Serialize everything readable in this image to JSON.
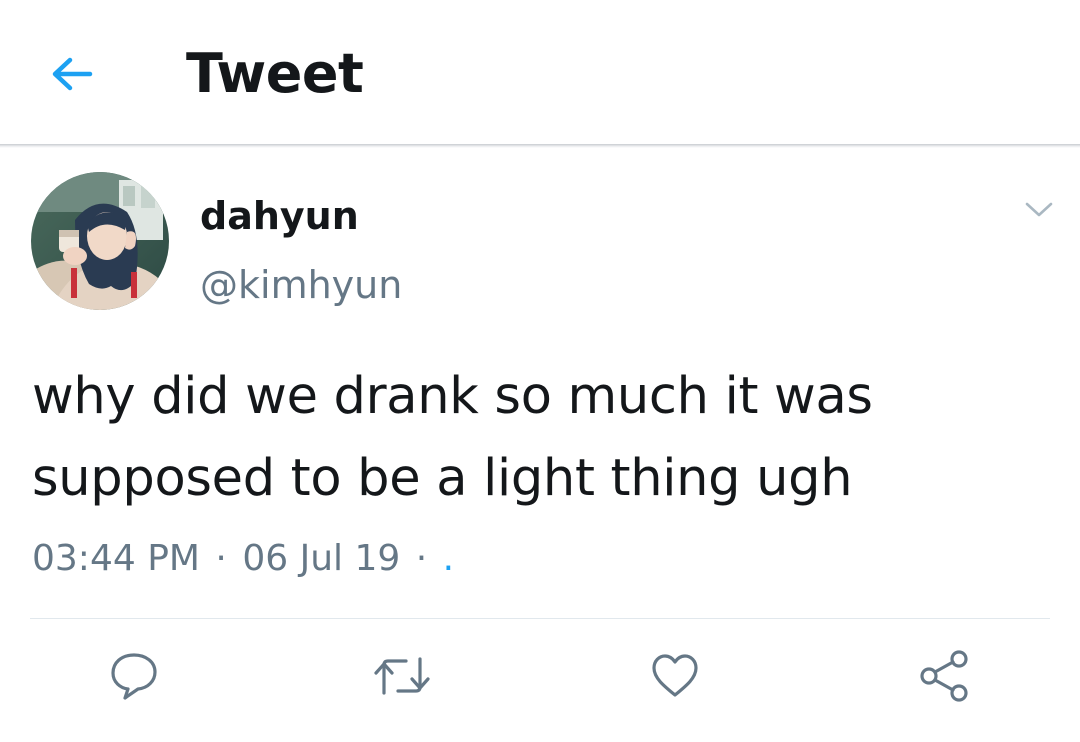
{
  "header": {
    "title": "Tweet",
    "back_icon": "arrow-left-icon"
  },
  "colors": {
    "accent": "#1da1f2",
    "text_primary": "#14171a",
    "text_secondary": "#657786",
    "icon_gray": "#657786",
    "divider": "#e1e8ed"
  },
  "tweet": {
    "author": {
      "name": "dahyun",
      "handle": "@kimhyun"
    },
    "text": "why did we drank so much it was supposed to be a light thing ugh",
    "time": "03:44 PM",
    "separator": "·",
    "date": "06 Jul 19",
    "via": "."
  },
  "actions": {
    "reply_icon": "speech-bubble-icon",
    "retweet_icon": "retweet-icon",
    "like_icon": "heart-icon",
    "share_icon": "share-icon",
    "more_icon": "chevron-down-icon"
  }
}
